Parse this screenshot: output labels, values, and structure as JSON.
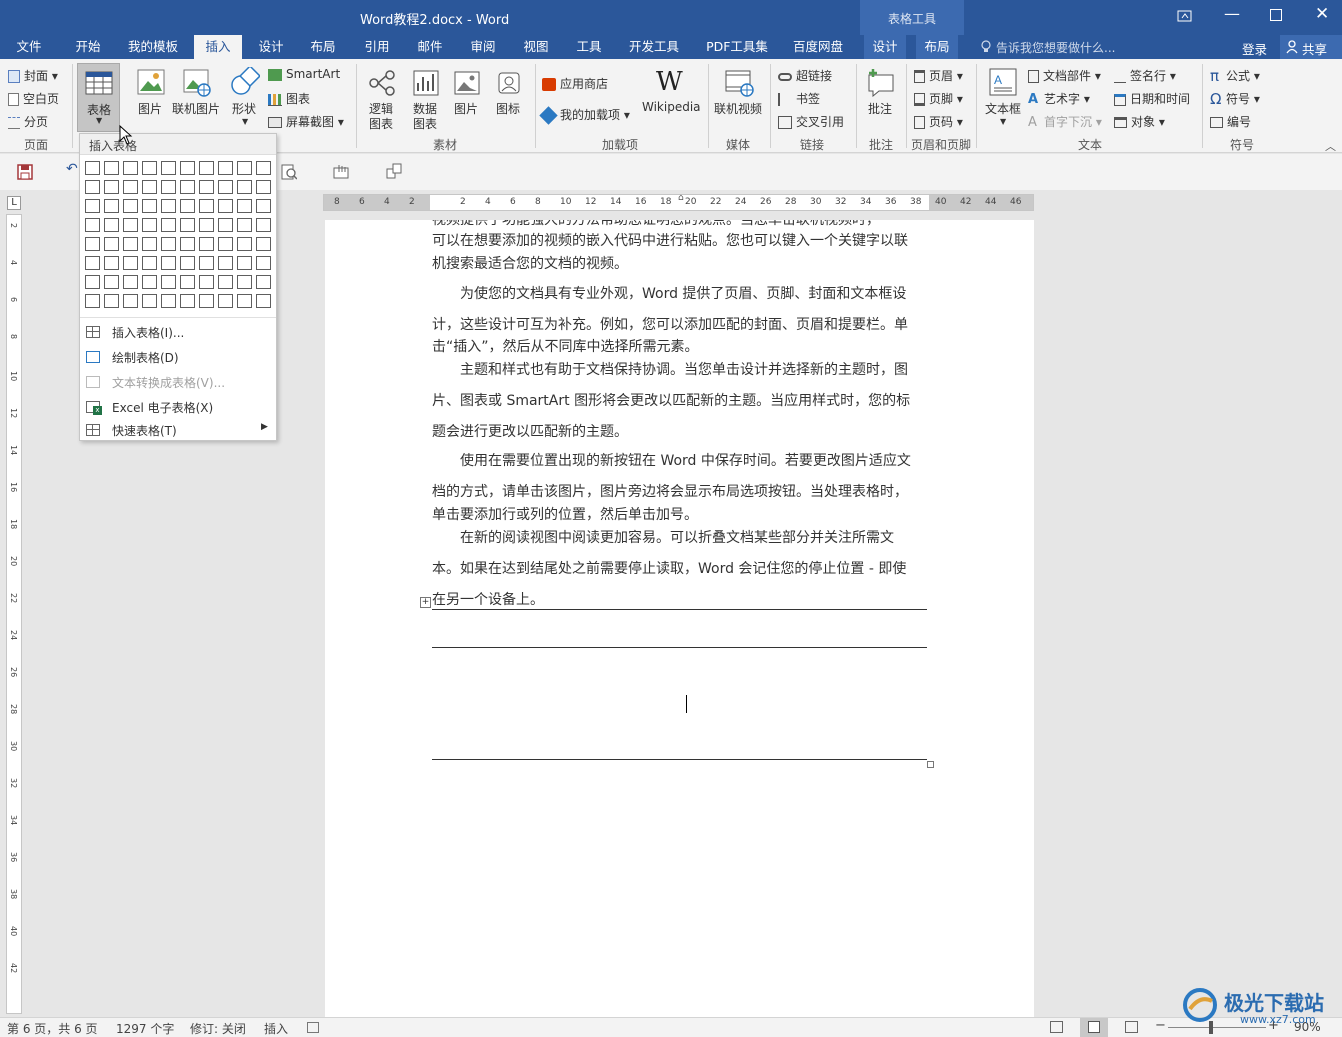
{
  "titlebar": {
    "doc_title": "Word教程2.docx - Word",
    "context_tools": "表格工具",
    "bg": "#2b579a"
  },
  "tabs": [
    {
      "label": "文件"
    },
    {
      "label": "开始"
    },
    {
      "label": "我的模板"
    },
    {
      "label": "插入"
    },
    {
      "label": "设计"
    },
    {
      "label": "布局"
    },
    {
      "label": "引用"
    },
    {
      "label": "邮件"
    },
    {
      "label": "审阅"
    },
    {
      "label": "视图"
    },
    {
      "label": "工具"
    },
    {
      "label": "开发工具"
    },
    {
      "label": "PDF工具集"
    },
    {
      "label": "百度网盘"
    },
    {
      "label": "设计"
    },
    {
      "label": "布局"
    }
  ],
  "tellme": "告诉我您想要做什么...",
  "login": "登录",
  "share": "共享",
  "ribbon": {
    "pages": {
      "cover": "封面",
      "blank": "空白页",
      "break": "分页",
      "group": "页面"
    },
    "table": {
      "label": "表格"
    },
    "illustrations": {
      "picture": "图片",
      "online_picture": "联机图片",
      "shapes": "形状",
      "smartart": "SmartArt",
      "chart": "图表",
      "screenshot": "屏幕截图"
    },
    "material": {
      "logic": "逻辑\n图表",
      "logic1": "逻辑",
      "logic2": "图表",
      "data1": "数据",
      "data2": "图表",
      "picture": "图片",
      "icon": "图标",
      "group": "素材"
    },
    "addins": {
      "store": "应用商店",
      "myaddins": "我的加载项",
      "wikipedia": "Wikipedia",
      "group": "加载项"
    },
    "media": {
      "online_video": "联机视频",
      "group": "媒体"
    },
    "links": {
      "hyperlink": "超链接",
      "bookmark": "书签",
      "crossref": "交叉引用",
      "group": "链接"
    },
    "comments": {
      "comment": "批注",
      "group": "批注"
    },
    "headerfooter": {
      "header": "页眉",
      "footer": "页脚",
      "pagenum": "页码",
      "group": "页眉和页脚"
    },
    "text": {
      "textbox": "文本框",
      "quickparts": "文档部件",
      "wordart": "艺术字",
      "dropcap": "首字下沉",
      "signature": "签名行",
      "datetime": "日期和时间",
      "object": "对象",
      "group": "文本"
    },
    "symbols": {
      "equation": "公式",
      "symbol": "符号",
      "number": "编号",
      "group": "符号"
    }
  },
  "dropdown": {
    "header": "插入表格",
    "items": [
      {
        "label": "插入表格(I)...",
        "disabled": false
      },
      {
        "label": "绘制表格(D)",
        "disabled": false
      },
      {
        "label": "文本转换成表格(V)...",
        "disabled": true
      },
      {
        "label": "Excel 电子表格(X)",
        "disabled": false
      },
      {
        "label": "快速表格(T)",
        "disabled": false
      }
    ]
  },
  "ruler": {
    "h_left": [
      "8",
      "6",
      "4",
      "2"
    ],
    "h_right": [
      "2",
      "4",
      "6",
      "8",
      "10",
      "12",
      "14",
      "16",
      "18",
      "20",
      "22",
      "24",
      "26",
      "28",
      "30",
      "32",
      "34",
      "36",
      "38",
      "40",
      "42",
      "44",
      "46"
    ],
    "v": [
      "2",
      "4",
      "6",
      "8",
      "10",
      "12",
      "14",
      "16",
      "18",
      "20",
      "22",
      "24",
      "26",
      "28",
      "30",
      "32",
      "34",
      "36",
      "38",
      "40",
      "42"
    ]
  },
  "document": {
    "lines": [
      "视频提供了功能强大的方法帮助您证明您的观点。当您单击联机视频时，",
      "可以在想要添加的视频的嵌入代码中进行粘贴。您也可以键入一个关键字以联",
      "机搜索最适合您的文档的视频。",
      "为使您的文档具有专业外观，Word 提供了页眉、页脚、封面和文本框设",
      "计，这些设计可互为补充。例如，您可以添加匹配的封面、页眉和提要栏。单",
      "击“插入”，然后从不同库中选择所需元素。",
      "主题和样式也有助于文档保持协调。当您单击设计并选择新的主题时，图",
      "片、图表或 SmartArt 图形将会更改以匹配新的主题。当应用样式时，您的标",
      "题会进行更改以匹配新的主题。",
      "使用在需要位置出现的新按钮在 Word 中保存时间。若要更改图片适应文",
      "档的方式，请单击该图片，图片旁边将会显示布局选项按钮。当处理表格时，",
      "单击要添加行或列的位置，然后单击加号。",
      "在新的阅读视图中阅读更加容易。可以折叠文档某些部分并关注所需文",
      "本。如果在达到结尾处之前需要停止读取，Word 会记住您的停止位置 - 即使",
      "在另一个设备上。"
    ]
  },
  "status": {
    "page": "第 6 页，共 6 页",
    "words": "1297 个字",
    "track": "修订: 关闭",
    "mode": "插入",
    "zoom": "90%"
  },
  "watermark": {
    "name": "极光下载站",
    "url": "www.xz7.com"
  }
}
